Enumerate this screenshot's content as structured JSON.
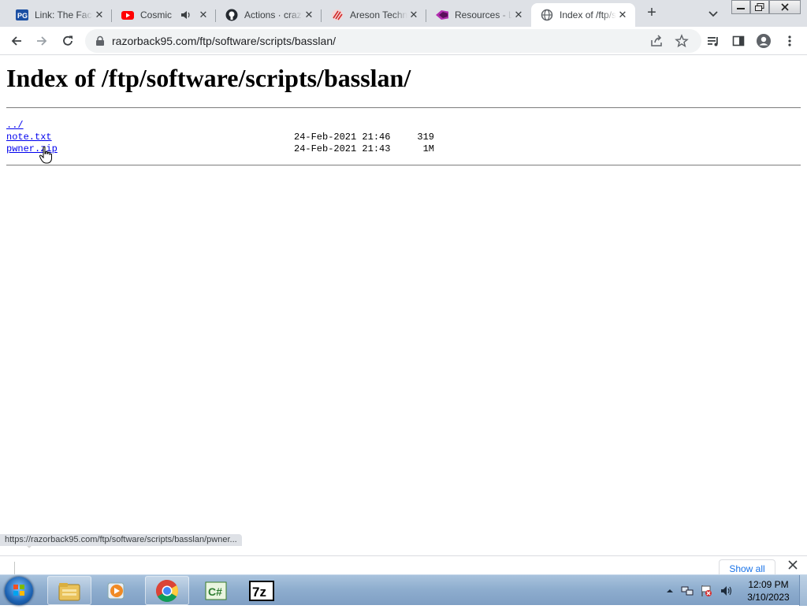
{
  "browser": {
    "tabs": [
      {
        "title": "Link: The Factory",
        "favicon": "pg-icon",
        "active": false
      },
      {
        "title": "Cosmic",
        "favicon": "youtube-icon",
        "audio": true,
        "active": false
      },
      {
        "title": "Actions · crazy",
        "favicon": "github-icon",
        "active": false
      },
      {
        "title": "Areson Technology",
        "favicon": "areson-icon",
        "active": false
      },
      {
        "title": "Resources - L",
        "favicon": "resources-icon",
        "active": false
      },
      {
        "title": "Index of /ftp/software",
        "favicon": "globe-icon",
        "active": true
      }
    ],
    "address": {
      "url": "razorback95.com/ftp/software/scripts/basslan/"
    }
  },
  "page": {
    "title": "Index of /ftp/software/scripts/basslan/",
    "entries": [
      {
        "name": "../",
        "date": "",
        "size": ""
      },
      {
        "name": "note.txt",
        "date": "24-Feb-2021 21:46",
        "size": "319"
      },
      {
        "name": "pwner.zip",
        "date": "24-Feb-2021 21:43",
        "size": "1M"
      }
    ]
  },
  "status_url": "https://razorback95.com/ftp/software/scripts/basslan/pwner...",
  "download_bar": {
    "show_all_label": "Show all"
  },
  "taskbar": {
    "apps": [
      "windows-explorer-icon",
      "media-player-icon",
      "chrome-icon",
      "csharp-icon",
      "7zip-icon"
    ],
    "clock": {
      "time": "12:09 PM",
      "date": "3/10/2023"
    }
  },
  "colors": {
    "tabstrip": "#dee1e6",
    "link": "#0000ee",
    "show_all": "#1a73e8"
  }
}
